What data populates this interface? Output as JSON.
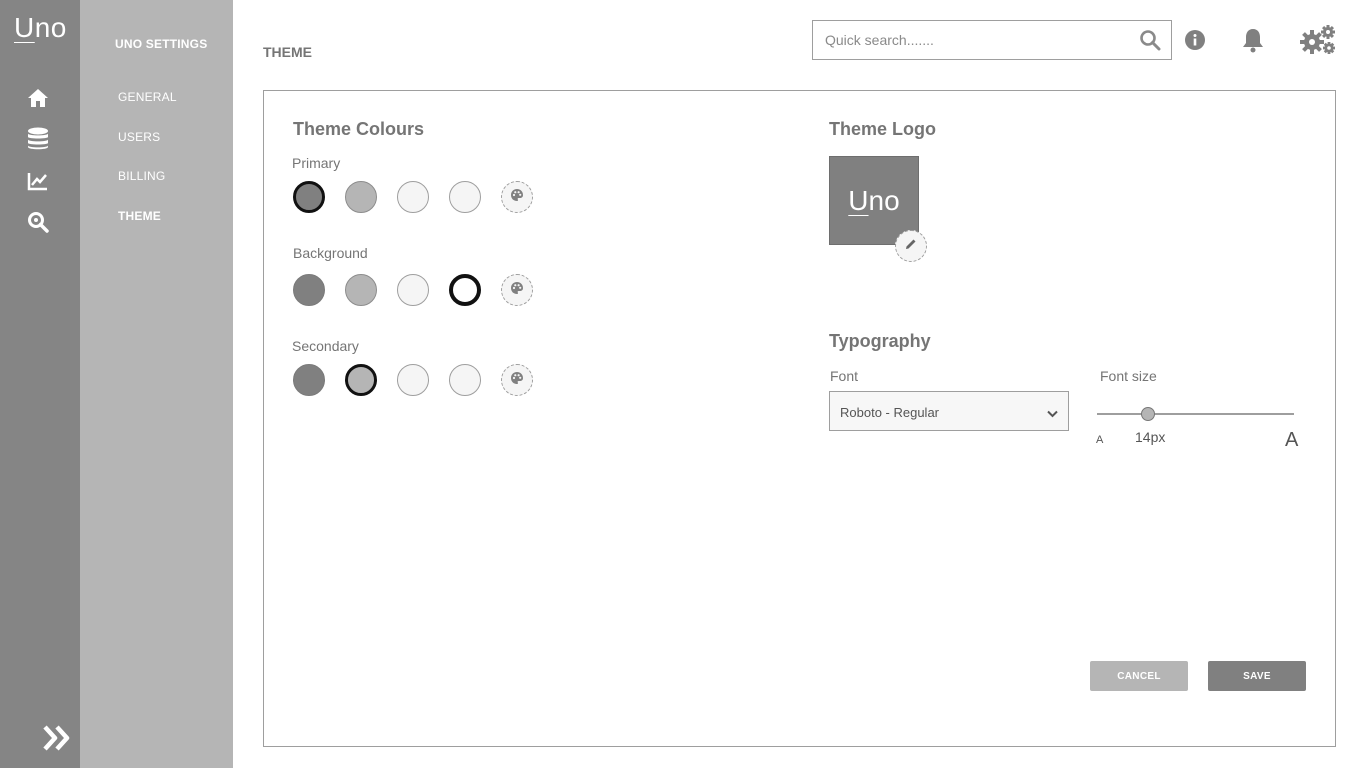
{
  "app": {
    "logo_text_u": "U",
    "logo_text_rest": "no"
  },
  "rail": {
    "icons": [
      "home-icon",
      "database-icon",
      "chart-icon",
      "search-analytics-icon"
    ],
    "expand_icon": "double-chevron-right-icon"
  },
  "subnav": {
    "heading": "UNO SETTINGS",
    "items": [
      {
        "label": "GENERAL"
      },
      {
        "label": "USERS"
      },
      {
        "label": "BILLING"
      },
      {
        "label": "THEME",
        "active": true
      }
    ]
  },
  "header": {
    "title": "THEME",
    "search_placeholder": "Quick search.......",
    "icons": [
      "info-icon",
      "bell-icon",
      "settings-gears-icon"
    ]
  },
  "theme_colours": {
    "title": "Theme Colours",
    "groups": [
      {
        "label": "Primary",
        "selected_index": 0
      },
      {
        "label": "Background",
        "selected_index": 3
      },
      {
        "label": "Secondary",
        "selected_index": 1
      }
    ],
    "palette": [
      "#808080",
      "#b5b5b5",
      "#f5f5f5",
      "#f5f5f5"
    ]
  },
  "theme_logo": {
    "title": "Theme Logo",
    "logo_u": "U",
    "logo_rest": "no"
  },
  "typography": {
    "title": "Typography",
    "font_label": "Font",
    "font_value": "Roboto - Regular",
    "font_size_label": "Font size",
    "font_size_value": "14px",
    "font_size_fraction": 0.26,
    "small_a": "A",
    "large_a": "A"
  },
  "actions": {
    "cancel_label": "CANCEL",
    "save_label": "SAVE"
  }
}
